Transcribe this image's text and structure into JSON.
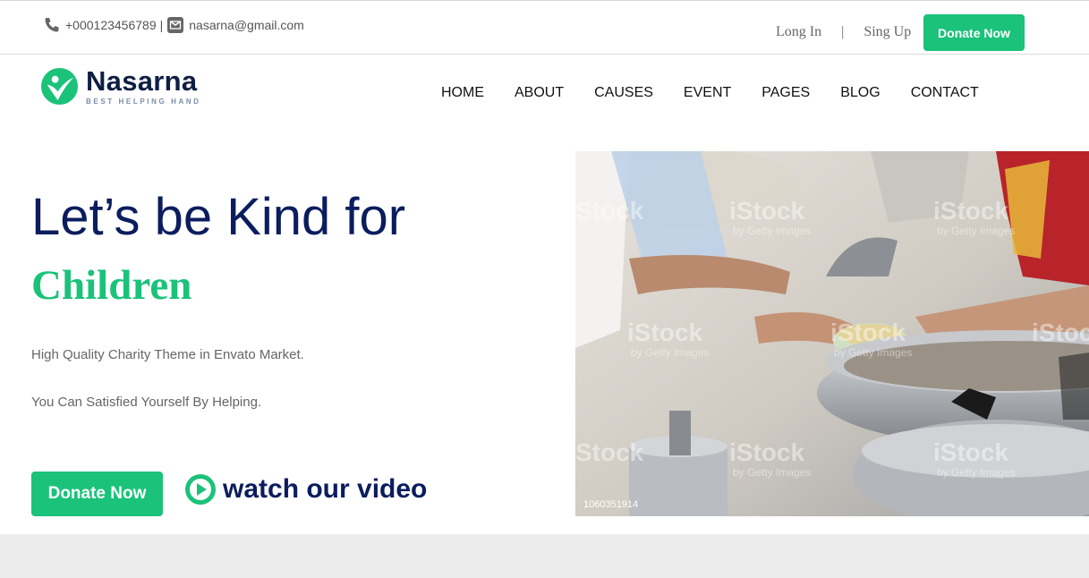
{
  "topbar": {
    "phone": "+000123456789",
    "separator": "|",
    "email": "nasarna@gmail.com",
    "login": "Long In",
    "auth_separator": "|",
    "signup": "Sing Up",
    "donate": "Donate Now"
  },
  "logo": {
    "name": "Nasarna",
    "tagline": "BEST HELPING HAND"
  },
  "nav": {
    "items": [
      "HOME",
      "ABOUT",
      "CAUSES",
      "EVENT",
      "PAGES",
      "BLOG",
      "CONTACT"
    ]
  },
  "hero": {
    "title": "Let’s be Kind for",
    "subtitle": "Children",
    "line1": "High Quality Charity Theme in Envato Market.",
    "line2": "You Can Satisfied Yourself By Helping.",
    "donate": "Donate Now",
    "video": "watch our video"
  },
  "photo": {
    "id": "1060351914",
    "watermark": "iStock",
    "watermark_sub": "by Getty Images"
  },
  "colors": {
    "accent": "#1bc27a",
    "navy": "#0b1d5e",
    "text_gray": "#666666",
    "band": "#ececec"
  }
}
